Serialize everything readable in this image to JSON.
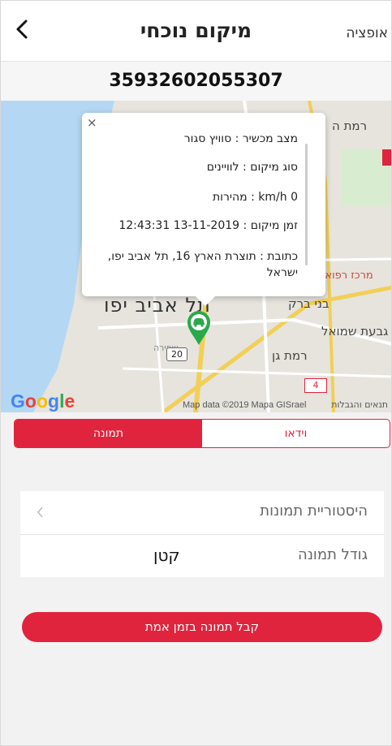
{
  "header": {
    "title": "מיקום נוכחי",
    "option_label": "אופציה"
  },
  "device_id": "35932602055307",
  "popup": {
    "device_status": "מצב מכשיר : סוויץ סגור",
    "location_type": "סוג מיקום : לוויינים",
    "speed": "km/h 0 : מהירות",
    "location_time": "זמן מיקום : 13-11-2019 12:43:31",
    "address": "כתובת : תוצרת הארץ 16, תל אביב יפו, ישראל"
  },
  "map": {
    "labels": {
      "ramat_hasharon": "רמת ה",
      "rafael_center": "מרכז רפואי ר",
      "tel_aviv": "תל אביב יפו",
      "bnei_brak": "בני ברק",
      "givat_shmuel": "גבעת שמואל",
      "ramat_gan": "רמת גן",
      "shapira": "שפירה"
    },
    "road_20": "20",
    "road_4": "4",
    "google": "Google",
    "map_data": "Map data ©2019 Mapa GISrael",
    "terms": "תנאים והגבלות"
  },
  "tabs": {
    "video": "וידאו",
    "photo": "תמונה"
  },
  "settings": {
    "photo_history": "היסטוריית תמונות",
    "photo_size_label": "גודל תמונה",
    "photo_size_value": "קטן"
  },
  "action_button": "קבל תמונה בזמן אמת",
  "colors": {
    "accent": "#e0243d",
    "marker": "#2aa84a"
  }
}
